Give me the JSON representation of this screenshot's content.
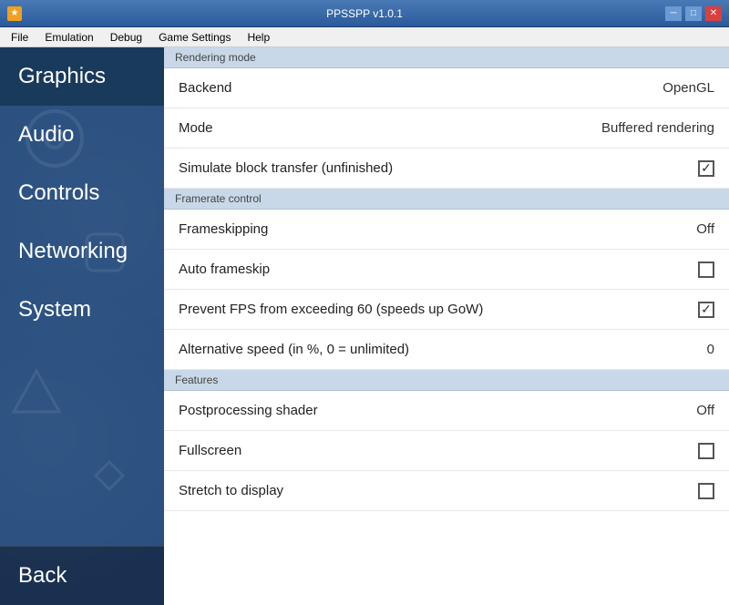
{
  "titlebar": {
    "title": "PPSSPP v1.0.1",
    "icon": "★",
    "minimize": "─",
    "maximize": "□",
    "close": "✕"
  },
  "menubar": {
    "items": [
      "File",
      "Emulation",
      "Debug",
      "Game Settings",
      "Help"
    ]
  },
  "sidebar": {
    "items": [
      {
        "id": "graphics",
        "label": "Graphics",
        "active": true
      },
      {
        "id": "audio",
        "label": "Audio",
        "active": false
      },
      {
        "id": "controls",
        "label": "Controls",
        "active": false
      },
      {
        "id": "networking",
        "label": "Networking",
        "active": false
      },
      {
        "id": "system",
        "label": "System",
        "active": false
      }
    ],
    "back_label": "Back"
  },
  "sections": [
    {
      "id": "rendering-mode",
      "header": "Rendering mode",
      "rows": [
        {
          "id": "backend",
          "label": "Backend",
          "value": "OpenGL",
          "type": "value"
        },
        {
          "id": "mode",
          "label": "Mode",
          "value": "Buffered rendering",
          "type": "value"
        },
        {
          "id": "simulate-block-transfer",
          "label": "Simulate block transfer (unfinished)",
          "value": "",
          "type": "checkbox",
          "checked": true
        }
      ]
    },
    {
      "id": "framerate-control",
      "header": "Framerate control",
      "rows": [
        {
          "id": "frameskipping",
          "label": "Frameskipping",
          "value": "Off",
          "type": "value"
        },
        {
          "id": "auto-frameskip",
          "label": "Auto frameskip",
          "value": "",
          "type": "checkbox",
          "checked": false
        },
        {
          "id": "prevent-fps",
          "label": "Prevent FPS from exceeding 60 (speeds up GoW)",
          "value": "",
          "type": "checkbox",
          "checked": true
        },
        {
          "id": "alternative-speed",
          "label": "Alternative speed (in %, 0 = unlimited)",
          "value": "0",
          "type": "value"
        }
      ]
    },
    {
      "id": "features",
      "header": "Features",
      "rows": [
        {
          "id": "postprocessing-shader",
          "label": "Postprocessing shader",
          "value": "Off",
          "type": "value"
        },
        {
          "id": "fullscreen",
          "label": "Fullscreen",
          "value": "",
          "type": "checkbox",
          "checked": false
        },
        {
          "id": "stretch-to-display",
          "label": "Stretch to display",
          "value": "",
          "type": "checkbox",
          "checked": false
        }
      ]
    }
  ]
}
